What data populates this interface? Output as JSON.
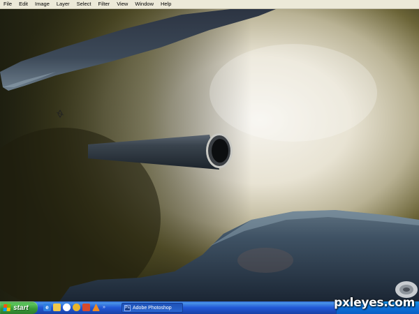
{
  "menubar": {
    "items": [
      "File",
      "Edit",
      "Image",
      "Layer",
      "Select",
      "Filter",
      "View",
      "Window",
      "Help"
    ]
  },
  "canvas": {
    "description_icons": [
      "move-cursor-icon"
    ],
    "colors": {
      "sky_light": "#f2efe6",
      "sky_dark": "#2c2a14",
      "metal_dark": "#23344a",
      "metal_mid": "#4d5f72"
    }
  },
  "taskbar": {
    "start_label": "start",
    "quicklaunch_icons": [
      "ie-icon",
      "folder-icon",
      "media-icon",
      "gear-icon",
      "paint-icon",
      "cone-icon"
    ],
    "task_button_label": "Adobe Photoshop"
  },
  "watermark": "pxleyes.com"
}
